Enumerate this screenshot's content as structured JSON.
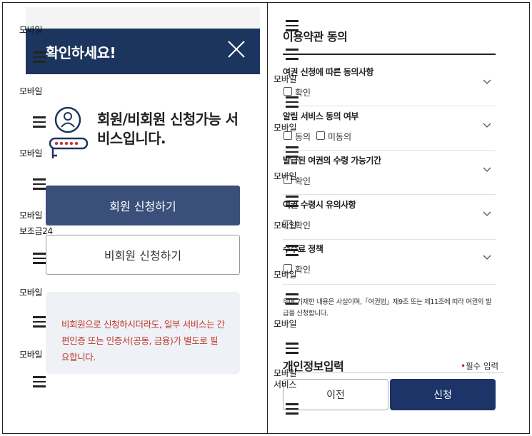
{
  "left": {
    "title": "확인하세요!",
    "message": "회원/비회원 신청가능 서비스입니다.",
    "member_button": "회원 신청하기",
    "nonmember_button": "비회원 신청하기",
    "notice": "비회원으로 신청하시더라도, 일부 서비스는 간편인증 또는 인증서(공동, 금융)가 별도로 필요합니다."
  },
  "overlay": {
    "mobile": "모바일",
    "subsidy": "보조금24",
    "service": "서비스"
  },
  "right": {
    "title": "이용약관 동의",
    "sections": [
      {
        "title": "여권 신청에 따른 동의사항",
        "options": [
          "확인"
        ]
      },
      {
        "title": "알림 서비스 동의 여부",
        "options": [
          "동의",
          "미동의"
        ]
      },
      {
        "title": "발급된 여권의 수령 가능기간",
        "options": [
          "확인"
        ]
      },
      {
        "title": "여권 수령시 유의사항",
        "options": [
          "확인"
        ]
      },
      {
        "title": "수수료 정책",
        "options": [
          "확인"
        ]
      }
    ],
    "footnote": "위에 기재한 내용은 사실이며,「여권법」제9조 또는 제11조에 따라 여권의 발급을 신청합니다.",
    "personal_info_title": "개인정보입력",
    "required_label": "필수 입력",
    "prev_button": "이전",
    "apply_button": "신청"
  },
  "colors": {
    "header_navy": "#1c355e",
    "primary_button": "#3a4f7a",
    "apply_button": "#1c3468",
    "notice_text": "#c0392b"
  }
}
